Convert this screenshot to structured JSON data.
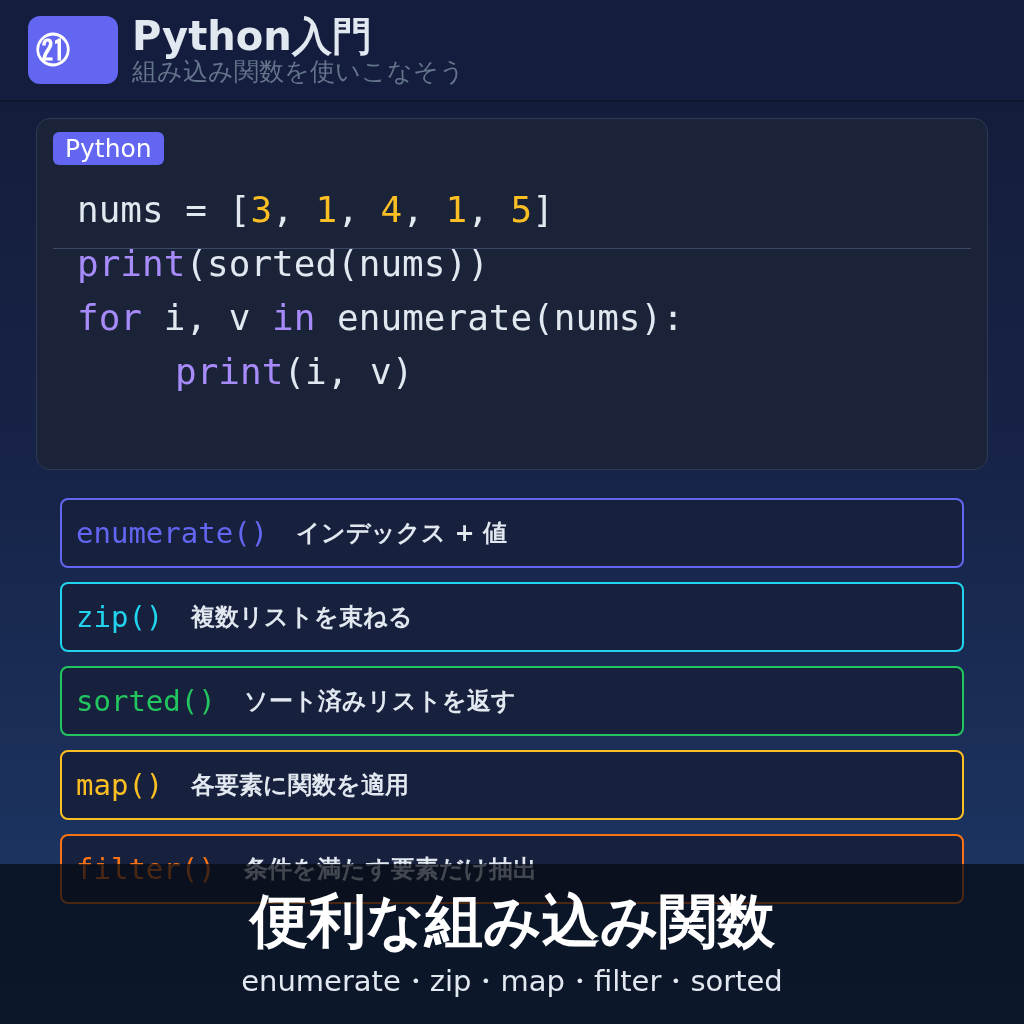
{
  "header": {
    "badge": "㉑",
    "title": "Python入門",
    "subtitle": "組み込み関数を使いこなそう"
  },
  "code_card": {
    "language": "Python",
    "lines": [
      {
        "indent": false,
        "tokens": [
          {
            "kind": "plain",
            "text": "nums = ["
          },
          {
            "kind": "number",
            "text": "3"
          },
          {
            "kind": "plain",
            "text": ", "
          },
          {
            "kind": "number",
            "text": "1"
          },
          {
            "kind": "plain",
            "text": ", "
          },
          {
            "kind": "number",
            "text": "4"
          },
          {
            "kind": "plain",
            "text": ", "
          },
          {
            "kind": "number",
            "text": "1"
          },
          {
            "kind": "plain",
            "text": ", "
          },
          {
            "kind": "number",
            "text": "5"
          },
          {
            "kind": "plain",
            "text": "]"
          }
        ]
      },
      {
        "indent": false,
        "tokens": [
          {
            "kind": "keyword",
            "text": "print"
          },
          {
            "kind": "plain",
            "text": "(sorted(nums))"
          }
        ]
      },
      {
        "indent": false,
        "tokens": [
          {
            "kind": "keyword",
            "text": "for"
          },
          {
            "kind": "plain",
            "text": " i, v "
          },
          {
            "kind": "keyword",
            "text": "in"
          },
          {
            "kind": "plain",
            "text": " enumerate(nums):"
          }
        ]
      },
      {
        "indent": true,
        "tokens": [
          {
            "kind": "keyword",
            "text": "print"
          },
          {
            "kind": "plain",
            "text": "(i, v)"
          }
        ]
      }
    ]
  },
  "functions": [
    {
      "name": "enumerate()",
      "description": "インデックス + 値",
      "color": "#6366f1"
    },
    {
      "name": "zip()",
      "description": "複数リストを束ねる",
      "color": "#22d3ee"
    },
    {
      "name": "sorted()",
      "description": "ソート済みリストを返す",
      "color": "#22c55e"
    },
    {
      "name": "map()",
      "description": "各要素に関数を適用",
      "color": "#fbbf24"
    },
    {
      "name": "filter()",
      "description": "条件を満たす要素だけ抽出",
      "color": "#f97316"
    }
  ],
  "caption": {
    "title": "便利な組み込み関数",
    "subtitle": "enumerate・zip・map・filter・sorted"
  }
}
